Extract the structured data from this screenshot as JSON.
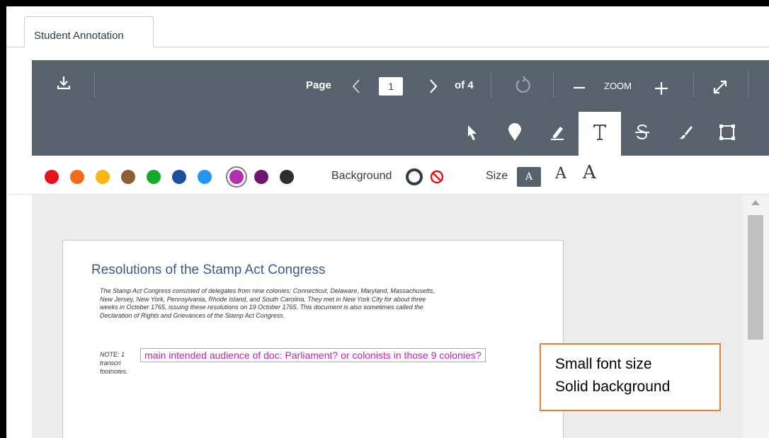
{
  "tabs": {
    "active_label": "Student Annotation"
  },
  "toolbar": {
    "page_label": "Page",
    "current_page": "1",
    "total_pages": "of 4",
    "zoom_label": "ZOOM",
    "icons": [
      "download-icon",
      "chevron-left-icon",
      "chevron-right-icon",
      "rotate-icon",
      "zoom-out-icon",
      "zoom-in-icon",
      "fullscreen-icon",
      "pointer-icon",
      "pin-icon",
      "highlight-icon",
      "text-icon",
      "strikeout-icon",
      "draw-icon",
      "area-icon"
    ],
    "active_tool": "text"
  },
  "colors": {
    "swatches": [
      "#e8141c",
      "#f26b1d",
      "#fcb514",
      "#8b5e34",
      "#16a82a",
      "#1f4ea1",
      "#2196f3",
      "#b52eb1",
      "#6f1770",
      "#2d2d2d"
    ],
    "selected": "#b52eb1",
    "background_label": "Background",
    "size_label": "Size",
    "size_small": "A",
    "size_medium": "A",
    "size_large": "A"
  },
  "document": {
    "title": "Resolutions of the Stamp Act Congress",
    "paragraph": "The Stamp Act Congress consisted of delegates from nine colonies: Connecticut, Delaware, Maryland, Massachusetts, New Jersey, New York, Pennsylvania, Rhode Island, and South Carolina.  They met in New York City for about three weeks in October 1765, issuing these resolutions on 19 October 1765. This document is also sometimes called the Declaration of Rights and Grievances of the Stamp Act Congress.",
    "note_line1": "NOTE: 1",
    "note_line2": "transcri",
    "note_line3": "footnotes.",
    "annotation": "main intended audience of doc: Parliament? or colonists in those 9 colonies?"
  },
  "callout": {
    "line1": "Small font size",
    "line2": "Solid background"
  }
}
